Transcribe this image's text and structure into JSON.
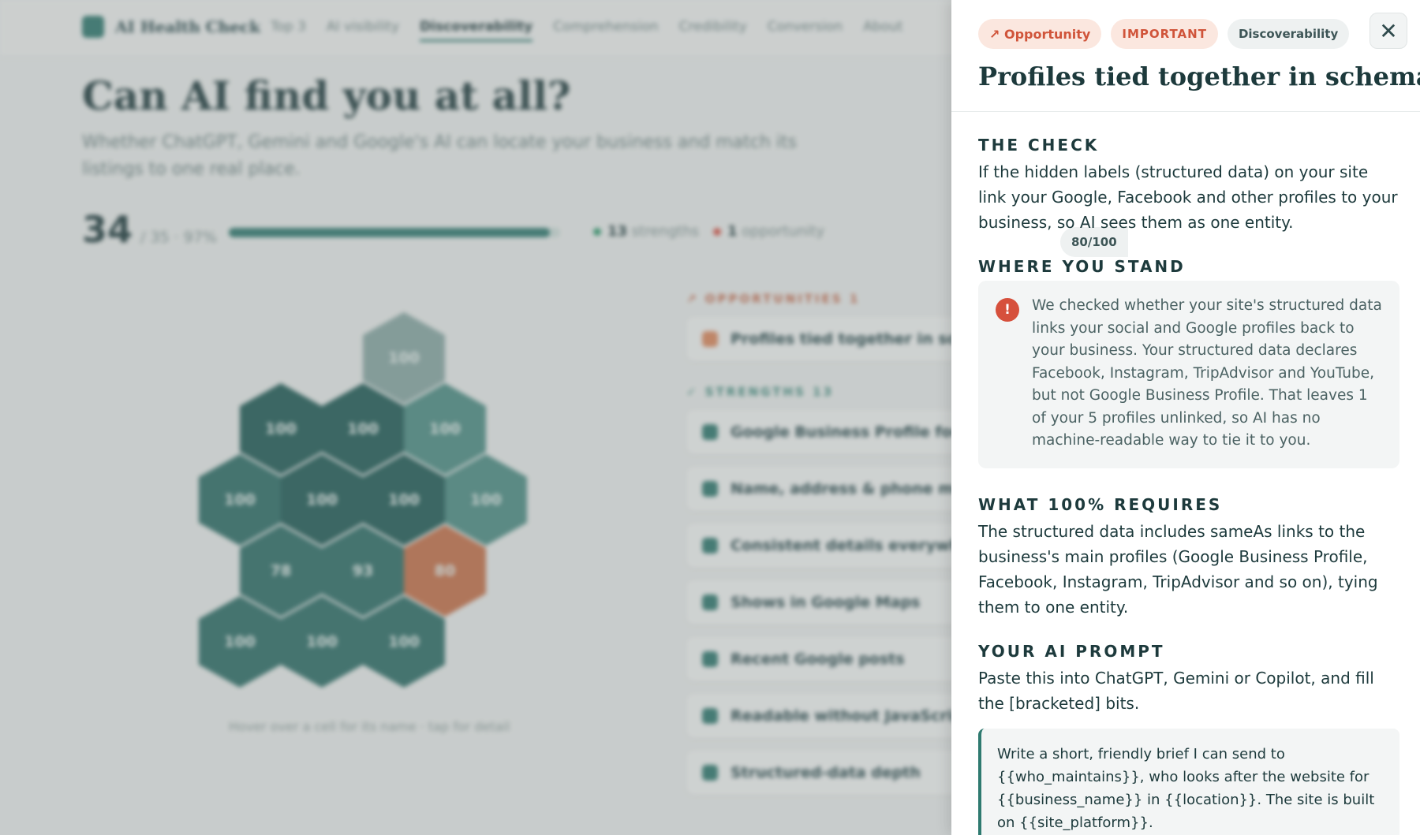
{
  "nav": {
    "brand": "AI Health Check",
    "links": [
      "Top 3",
      "AI visibility",
      "Discoverability",
      "Comprehension",
      "Credibility",
      "Conversion",
      "About"
    ],
    "active_index": 2
  },
  "hero": {
    "title": "Can AI find you at all?",
    "subtitle": "Whether ChatGPT, Gemini and Google's AI can locate your business and match its listings to one real place."
  },
  "score": {
    "value": "34",
    "detail": "/ 35 · 97%",
    "progress": 0.97,
    "strengths_count": "13",
    "strengths_label": "strengths",
    "opportunity_count": "1",
    "opportunity_label": "opportunity"
  },
  "hexmap": {
    "cells": [
      "100",
      "100",
      "100",
      "100",
      "100",
      "100",
      "100",
      "100",
      "78",
      "93",
      "80",
      "100",
      "100",
      "100"
    ],
    "caption": "Hover over a cell for its name · tap for detail"
  },
  "opportunities": {
    "label": "↗ OPPORTUNITIES",
    "count": "1",
    "items": [
      "Profiles tied together in schema"
    ]
  },
  "strengths": {
    "label": "✓ STRENGTHS",
    "count": "13",
    "items": [
      "Google Business Profile found",
      "Name, address & phone match",
      "Consistent details everywhere",
      "Shows in Google Maps",
      "Recent Google posts",
      "Readable without JavaScript",
      "Structured-data depth"
    ]
  },
  "drawer": {
    "badge_opportunity": "↗ Opportunity",
    "badge_importance": "IMPORTANT",
    "badge_category": "Discoverability",
    "badge_score": "80/100",
    "close_glyph": "✕",
    "title": "Profiles tied together in schema",
    "check_heading": "THE CHECK",
    "check_text": "If the hidden labels (structured data) on your site link your Google, Facebook and other profiles to your business, so AI sees them as one entity.",
    "stand_heading": "WHERE YOU STAND",
    "stand_icon": "!",
    "stand_text": "We checked whether your site's structured data links your social and Google profiles back to your business. Your structured data declares Facebook, Instagram, TripAdvisor and YouTube, but not Google Business Profile. That leaves 1 of your 5 profiles unlinked, so AI has no machine-readable way to tie it to you.",
    "requires_heading": "WHAT 100% REQUIRES",
    "requires_text": "The structured data includes sameAs links to the business's main profiles (Google Business Profile, Facebook, Instagram, TripAdvisor and so on), tying them to one entity.",
    "prompt_heading": "YOUR AI PROMPT",
    "prompt_intro": "Paste this into ChatGPT, Gemini or Copilot, and fill the [bracketed] bits.",
    "prompt_text": "Write a short, friendly brief I can send to {{who_maintains}}, who looks after the website for {{business_name}} in {{location}}. The site is built on {{site_platform}}."
  },
  "colors": {
    "accent": "#2f7a70",
    "opportunity": "#d0543a",
    "alert": "#d6503c"
  }
}
